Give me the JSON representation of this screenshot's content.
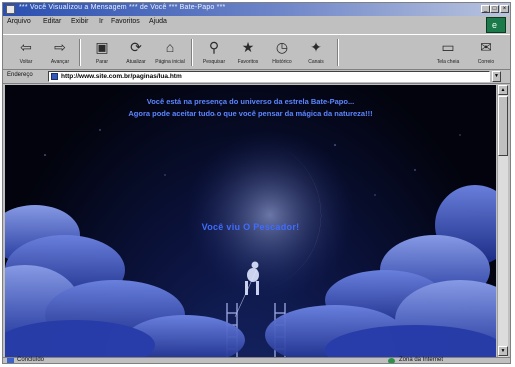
{
  "window": {
    "title": "*** Você Visualizou a Mensagem *** de Você *** Bate-Papo ***"
  },
  "menu": [
    "Arquivo",
    "Editar",
    "Exibir",
    "Ir",
    "Favoritos",
    "Ajuda"
  ],
  "toolbar": [
    {
      "label": "Voltar",
      "icon": "back-arrow-icon"
    },
    {
      "label": "Avançar",
      "icon": "forward-arrow-icon"
    },
    {
      "label": "Parar",
      "icon": "stop-icon"
    },
    {
      "label": "Atualizar",
      "icon": "refresh-icon"
    },
    {
      "label": "Página inicial",
      "icon": "home-icon"
    },
    {
      "label": "Pesquisar",
      "icon": "search-icon"
    },
    {
      "label": "Favoritos",
      "icon": "favorites-icon"
    },
    {
      "label": "Histórico",
      "icon": "history-icon"
    },
    {
      "label": "Canais",
      "icon": "channels-icon"
    },
    {
      "label": "Tela cheia",
      "icon": "fullscreen-icon"
    },
    {
      "label": "Correio",
      "icon": "mail-icon"
    }
  ],
  "address": {
    "label": "Endereço",
    "url": "http://www.site.com.br/paginas/lua.htm"
  },
  "content": {
    "line1": "Você está na presença do universo da estrela Bate-Papo...",
    "line2": "Agora pode aceitar tudo o que você pensar da mágica da natureza!!!",
    "center": "Você viu O Pescador!"
  },
  "status": {
    "left": "Concluído",
    "right": "Zona da Internet"
  },
  "colors": {
    "content_text": "#5d86ff",
    "title_bar": "#2a4fb0"
  }
}
